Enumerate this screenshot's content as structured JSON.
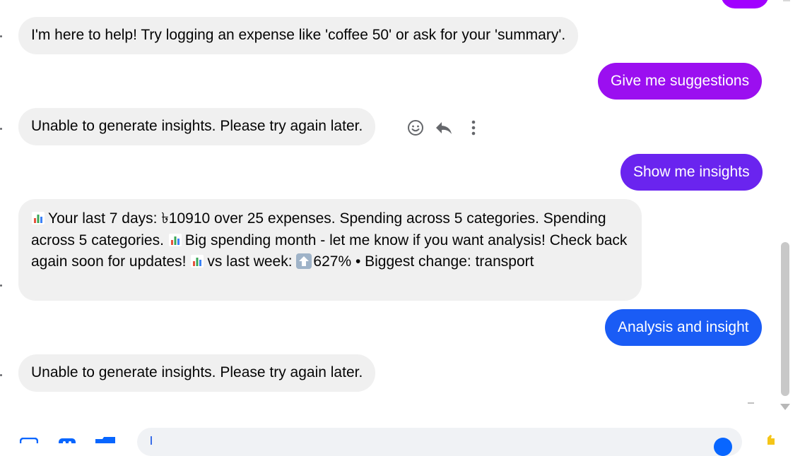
{
  "messages": [
    {
      "side": "in",
      "text": "I'm here to help! Try logging an expense like 'coffee 50' or ask for your 'summary'."
    },
    {
      "side": "out",
      "text": "Give me suggestions",
      "color": "#9b0ff0"
    },
    {
      "side": "in",
      "text": "Unable to generate insights. Please try again later."
    },
    {
      "side": "out",
      "text": "Show me insights",
      "color": "#6a24ef"
    },
    {
      "side": "in",
      "parts": {
        "p1": "Your last 7 days: ৳10910 over 25 expenses. Spending across 5 categories. Spending across 5 categories.",
        "p2": "Big spending month - let me know if you want analysis! Check back again soon for updates!",
        "p3": "vs last week:",
        "p4": "627% • Biggest change: transport"
      }
    },
    {
      "side": "out",
      "text": "Analysis and insight",
      "color": "#1a5cf5"
    },
    {
      "side": "in",
      "text": "Unable to generate insights. Please try again later."
    }
  ],
  "message_actions": [
    {
      "icon": "smiley-icon",
      "glyph": "☺"
    },
    {
      "icon": "reply-icon",
      "glyph": "↩"
    },
    {
      "icon": "more-vertical-icon",
      "glyph": "⋮"
    }
  ],
  "colors": {
    "incoming_bg": "#f0f0f0",
    "accent_blue": "#0866ff",
    "scroll_thumb": "#c8c8c8"
  },
  "composer": {
    "tools": [
      "image-icon",
      "sticker-icon",
      "gif-icon"
    ],
    "emoji_icon": "emoji-icon",
    "like_icon": "thumbs-up-icon"
  }
}
